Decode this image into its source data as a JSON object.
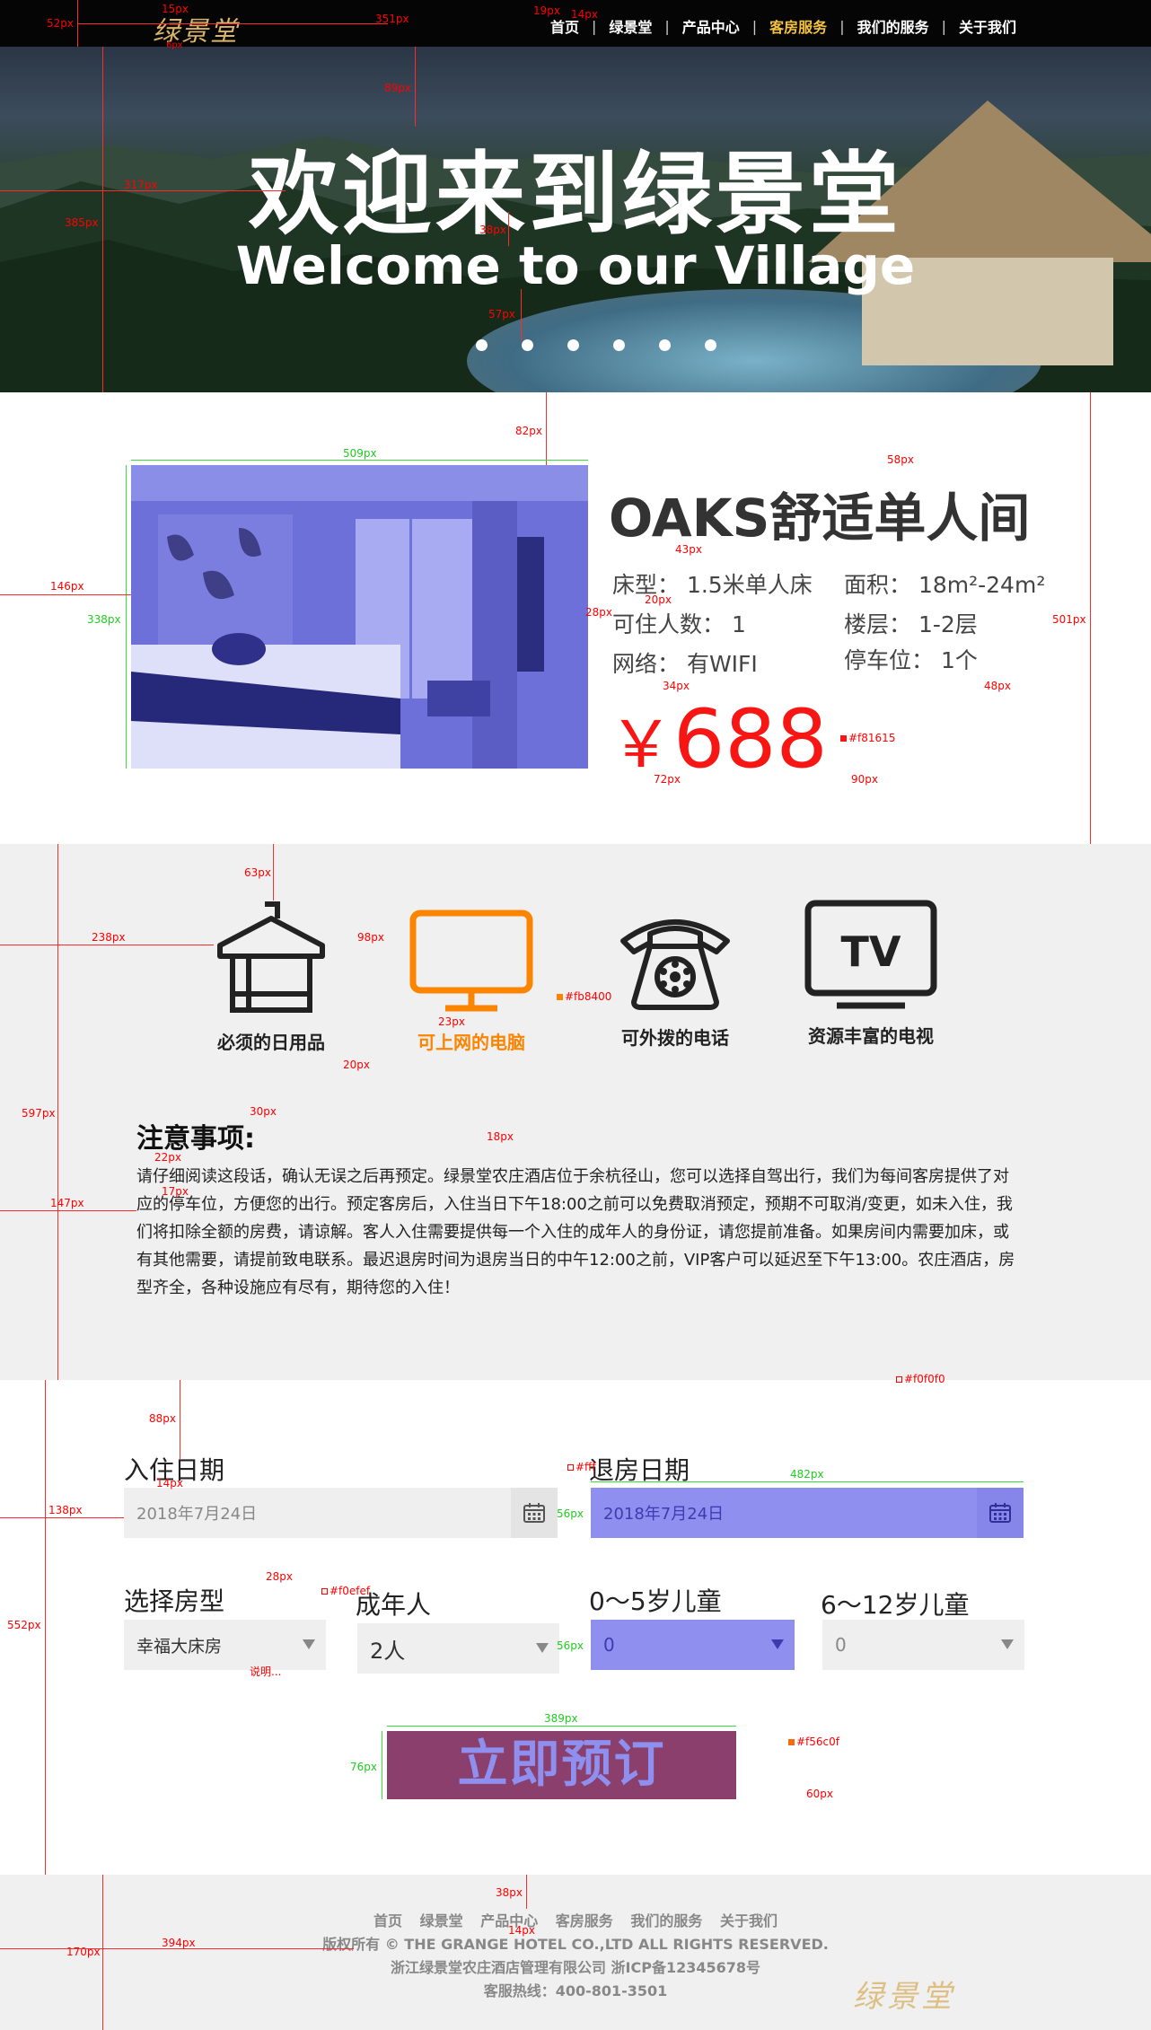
{
  "header": {
    "logo": "绿景堂",
    "menu": [
      {
        "label": "首页",
        "active": false
      },
      {
        "label": "绿景堂",
        "active": false
      },
      {
        "label": "产品中心",
        "active": false
      },
      {
        "label": "客房服务",
        "active": true
      },
      {
        "label": "我们的服务",
        "active": false
      },
      {
        "label": "关于我们",
        "active": false
      }
    ],
    "separator": "|",
    "active_color": "#f5c242"
  },
  "hero": {
    "title": "欢迎来到绿景堂",
    "subtitle": "Welcome to our Village",
    "slide_count": 6
  },
  "room": {
    "name": "OAKS舒适单人间",
    "bed": "床型：  1.5米单人床",
    "occupancy": "可住人数：  1",
    "network": "网络：  有WIFI",
    "area": "面积：  18m²-24m²",
    "floor": "楼层：  1-2层",
    "parking": "停车位：  1个",
    "price_symbol": "￥",
    "price": "688",
    "price_color": "#f81615"
  },
  "features": {
    "items": [
      {
        "label": "必须的日用品",
        "icon": "hanger-icon",
        "highlight": false
      },
      {
        "label": "可上网的电脑",
        "icon": "monitor-icon",
        "highlight": true
      },
      {
        "label": "可外拨的电话",
        "icon": "telephone-icon",
        "highlight": false
      },
      {
        "label": "资源丰富的电视",
        "icon": "tv-icon",
        "highlight": false
      }
    ],
    "highlight_color": "#fb8400",
    "background": "#f0f0f0"
  },
  "notice": {
    "title": "注意事项:",
    "text": "请仔细阅读这段话，确认无误之后再预定。绿景堂农庄酒店位于余杭径山，您可以选择自驾出行，我们为每间客房提供了对应的停车位，方便您的出行。预定客房后，入住当日下午18:00之前可以免费取消预定，预期不可取消/变更，如未入住，我们将扣除全额的房费，请谅解。客人入住需要提供每一个入住的成年人的身份证，请您提前准备。如果房间内需要加床，或有其他需要，请提前致电联系。最迟退房时间为退房当日的中午12:00之前，VIP客户可以延迟至下午13:00。农庄酒店，房型齐全，各种设施应有尽有，期待您的入住！"
  },
  "form": {
    "checkin_label": "入住日期",
    "checkin_value": "2018年7月24日",
    "checkout_label": "退房日期",
    "checkout_value": "2018年7月24日",
    "room_type_label": "选择房型",
    "room_type_value": "幸福大床房",
    "adults_label": "成年人",
    "adults_value": "2人",
    "kids_0_5_label": "0～5岁儿童",
    "kids_0_5_value": "0",
    "kids_6_12_label": "6～12岁儿童",
    "kids_6_12_value": "0",
    "book_label": "立即预订",
    "field_bg": "#f0efef",
    "button_color": "#f56c0f"
  },
  "footer": {
    "links": [
      "首页",
      "绿景堂",
      "产品中心",
      "客房服务",
      "我们的服务",
      "关于我们"
    ],
    "copyright": "版权所有 © THE GRANGE HOTEL CO.,LTD ALL RIGHTS RESERVED.",
    "company": "浙江绿景堂农庄酒店管理有限公司 浙ICP备12345678号",
    "hotline": "客服热线：400-801-3501",
    "logo": "绿景堂"
  },
  "annotations": {
    "a15": "15px",
    "a52": "52px",
    "a351": "351px",
    "a19": "19px",
    "a14a": "14px",
    "a6": "6px",
    "a89": "89px",
    "a317": "317px",
    "a385": "385px",
    "a38a": "38px",
    "a57": "57px",
    "a82": "82px",
    "a509": "509px",
    "a58": "58px",
    "a146": "146px",
    "a338": "338px",
    "a43": "43px",
    "a28a": "28px",
    "a20a": "20px",
    "a501": "501px",
    "a34": "34px",
    "a48": "48px",
    "c_f81615": "#f81615",
    "a72": "72px",
    "a90": "90px",
    "a63": "63px",
    "a238": "238px",
    "a98": "98px",
    "c_fb8400": "#fb8400",
    "a23": "23px",
    "a20b": "20px",
    "a597": "597px",
    "a30": "30px",
    "a18": "18px",
    "a22": "22px",
    "a17": "17px",
    "a147": "147px",
    "c_f0f0f0": "#f0f0f0",
    "a88": "88px",
    "a14b": "14px",
    "a138": "138px",
    "a56a": "56px",
    "a482": "482px",
    "c_fff": "#fff",
    "a28b": "28px",
    "c_f0efef": "#f0efef",
    "a552": "552px",
    "note": "说明...",
    "a56b": "56px",
    "a389": "389px",
    "c_f56c0f": "#f56c0f",
    "a76": "76px",
    "a60": "60px",
    "a38b": "38px",
    "a14c": "14px",
    "a170": "170px",
    "a394": "394px"
  }
}
